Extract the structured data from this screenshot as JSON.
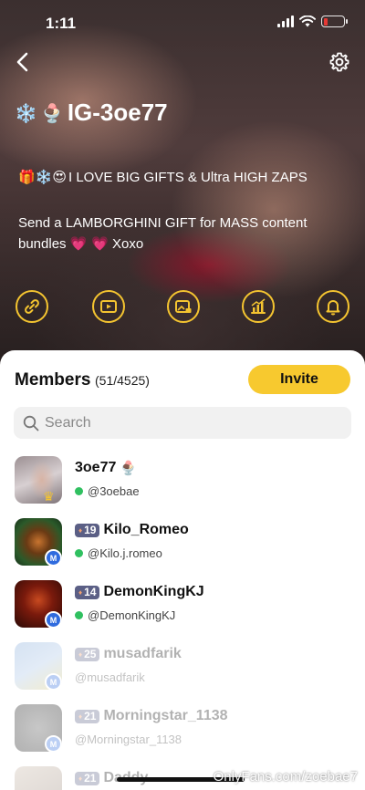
{
  "status_bar": {
    "time": "1:11",
    "battery_color": "#e53935"
  },
  "header": {
    "back_icon": "chevron-left-icon",
    "settings_icon": "gear-icon",
    "title_emoji_1": "❄️",
    "title_emoji_2": "🍨",
    "title": "IG-3oe77"
  },
  "bio": {
    "line1_emoji": "🎁❄️😍",
    "line1_text": "I LOVE BIG GIFTS & Ultra HIGH ZAPS",
    "line2_text": "Send a LAMBORGHINI GIFT for MASS content bundles",
    "line2_emoji": "💗 💗",
    "line2_tail": "Xoxo"
  },
  "actions": [
    {
      "icon": "link-icon"
    },
    {
      "icon": "video-icon"
    },
    {
      "icon": "locked-image-icon"
    },
    {
      "icon": "stats-icon"
    },
    {
      "icon": "bell-icon"
    }
  ],
  "members_panel": {
    "title": "Members",
    "count": "(51/4525)",
    "invite_label": "Invite",
    "search_placeholder": "Search"
  },
  "members": [
    {
      "name": "3oe77",
      "name_emoji": "🍨",
      "handle": "@3oebae",
      "level": "",
      "online": true,
      "badge": "crown",
      "faded": false
    },
    {
      "name": "Kilo_Romeo",
      "handle": "@Kilo.j.romeo",
      "level": "19",
      "online": true,
      "badge": "M",
      "faded": false
    },
    {
      "name": "DemonKingKJ",
      "handle": "@DemonKingKJ",
      "level": "14",
      "online": true,
      "badge": "M",
      "faded": false
    },
    {
      "name": "musadfarik",
      "handle": "@musadfarik",
      "level": "25",
      "online": false,
      "badge": "M",
      "faded": true
    },
    {
      "name": "Morningstar_1138",
      "handle": "@Morningstar_1138",
      "level": "21",
      "online": false,
      "badge": "M",
      "faded": true
    },
    {
      "name": "Daddy",
      "handle": "",
      "level": "21",
      "online": false,
      "badge": "",
      "faded": true
    }
  ],
  "watermark": "OnlyFans.com/zoebae7",
  "colors": {
    "accent": "#f7c92f",
    "level_badge": "#5b5f85",
    "online": "#30c060",
    "m_badge": "#2f6bde"
  }
}
